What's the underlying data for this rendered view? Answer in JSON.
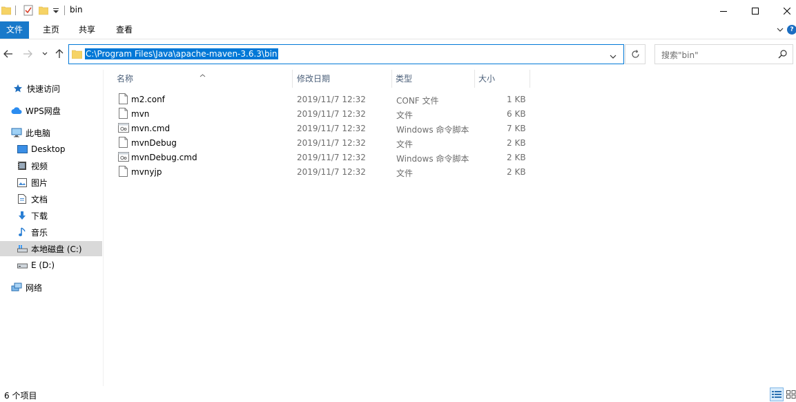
{
  "window": {
    "title": "bin"
  },
  "ribbon": {
    "tabs": [
      {
        "label": "文件"
      },
      {
        "label": "主页"
      },
      {
        "label": "共享"
      },
      {
        "label": "查看"
      }
    ]
  },
  "address": {
    "path": "C:\\Program Files\\Java\\apache-maven-3.6.3\\bin"
  },
  "search": {
    "placeholder": "搜索\"bin\""
  },
  "sidebar": {
    "items": [
      {
        "label": "快速访问",
        "icon": "star-icon"
      },
      {
        "label": "WPS网盘",
        "icon": "cloud-icon"
      },
      {
        "label": "此电脑",
        "icon": "computer-icon"
      },
      {
        "label": "Desktop",
        "icon": "desktop-icon"
      },
      {
        "label": "视频",
        "icon": "video-icon"
      },
      {
        "label": "图片",
        "icon": "picture-icon"
      },
      {
        "label": "文档",
        "icon": "document-icon"
      },
      {
        "label": "下载",
        "icon": "download-icon"
      },
      {
        "label": "音乐",
        "icon": "music-icon"
      },
      {
        "label": "本地磁盘 (C:)",
        "icon": "drive-icon"
      },
      {
        "label": "E (D:)",
        "icon": "drive-icon"
      },
      {
        "label": "网络",
        "icon": "network-icon"
      }
    ]
  },
  "columns": {
    "name": "名称",
    "modified": "修改日期",
    "type": "类型",
    "size": "大小"
  },
  "files": [
    {
      "name": "m2.conf",
      "modified": "2019/11/7 12:32",
      "type": "CONF 文件",
      "size": "1 KB",
      "icon": "file-icon"
    },
    {
      "name": "mvn",
      "modified": "2019/11/7 12:32",
      "type": "文件",
      "size": "6 KB",
      "icon": "file-icon"
    },
    {
      "name": "mvn.cmd",
      "modified": "2019/11/7 12:32",
      "type": "Windows 命令脚本",
      "size": "7 KB",
      "icon": "script-icon"
    },
    {
      "name": "mvnDebug",
      "modified": "2019/11/7 12:32",
      "type": "文件",
      "size": "2 KB",
      "icon": "file-icon"
    },
    {
      "name": "mvnDebug.cmd",
      "modified": "2019/11/7 12:32",
      "type": "Windows 命令脚本",
      "size": "2 KB",
      "icon": "script-icon"
    },
    {
      "name": "mvnyjp",
      "modified": "2019/11/7 12:32",
      "type": "文件",
      "size": "2 KB",
      "icon": "file-icon"
    }
  ],
  "status": {
    "count": "6 个项目"
  },
  "colors": {
    "accent": "#0078d7",
    "file_tab": "#1979ca",
    "folder": "#f6d365",
    "selected_nav": "#d9d9d9"
  }
}
